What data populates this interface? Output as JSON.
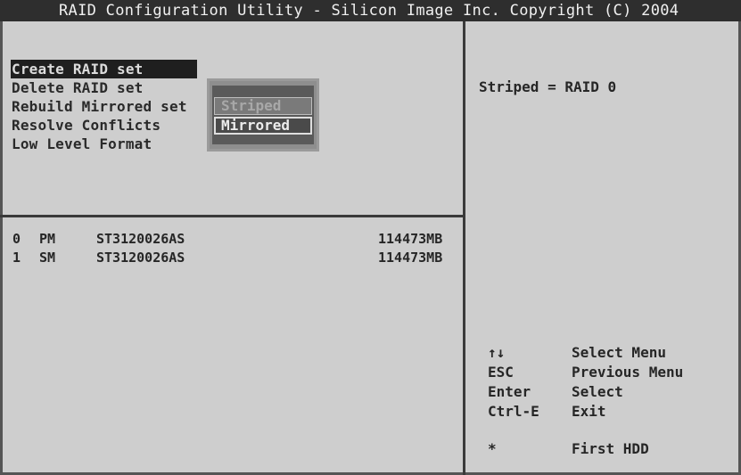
{
  "title": "RAID Configuration Utility - Silicon Image Inc. Copyright (C) 2004",
  "menu": {
    "items": [
      {
        "label": "Create RAID set"
      },
      {
        "label": "Delete RAID set"
      },
      {
        "label": "Rebuild Mirrored set"
      },
      {
        "label": "Resolve Conflicts"
      },
      {
        "label": "Low Level Format"
      }
    ],
    "selected_index": 0
  },
  "popup": {
    "options": [
      {
        "label": "Striped",
        "state": "disabled"
      },
      {
        "label": "Mirrored",
        "state": "highlighted"
      }
    ]
  },
  "drives": [
    {
      "id": "0",
      "channel": "PM",
      "model": "ST3120026AS",
      "size": "114473MB"
    },
    {
      "id": "1",
      "channel": "SM",
      "model": "ST3120026AS",
      "size": "114473MB"
    }
  ],
  "info": {
    "text": "Striped = RAID 0"
  },
  "keys": [
    {
      "key": "↑↓",
      "desc": "Select Menu"
    },
    {
      "key": "ESC",
      "desc": "Previous Menu"
    },
    {
      "key": "Enter",
      "desc": "Select"
    },
    {
      "key": "Ctrl-E",
      "desc": "Exit"
    },
    {
      "key": "*",
      "desc": "First HDD"
    }
  ],
  "colors": {
    "background": "#cecece",
    "titlebar": "#2e2e2e",
    "text": "#262626",
    "selection": "#1f1f1f"
  }
}
